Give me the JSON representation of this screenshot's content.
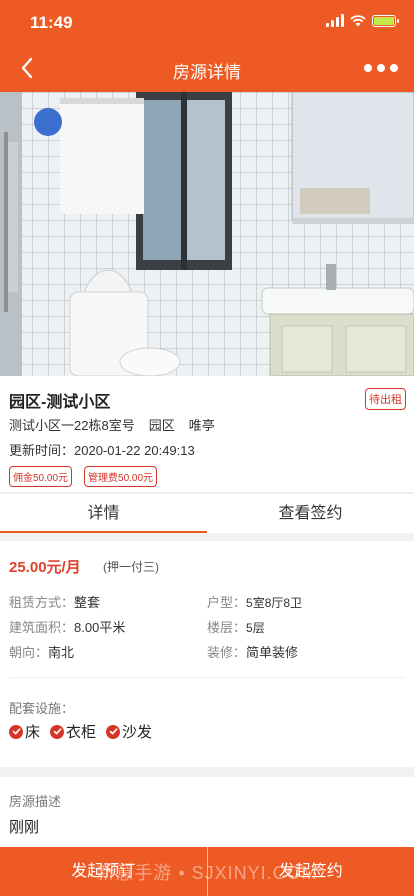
{
  "status_bar": {
    "time": "11:49"
  },
  "nav": {
    "title": "房源详情"
  },
  "property": {
    "name": "园区-测试小区",
    "rent_status": "待出租",
    "address": "测试小区一22栋8室号",
    "district": "园区",
    "area_name": "唯亭",
    "updated_label": "更新时间：",
    "updated_value": "2020-01-22 20:49:13",
    "tags": [
      "佣金50.00元",
      "管理费50.00元"
    ]
  },
  "tabs": [
    {
      "label": "详情",
      "active": true
    },
    {
      "label": "查看签约",
      "active": false
    }
  ],
  "detail": {
    "price": "25.00元/月",
    "payment": "(押一付三)",
    "rent_type_label": "租赁方式：",
    "rent_type": "整套",
    "layout_label": "户型：",
    "layout": "5室8厅8卫",
    "area_label": "建筑面积：",
    "area": "8.00平米",
    "floor_label": "楼层：",
    "floor": "5层",
    "orientation_label": "朝向：",
    "orientation": "南北",
    "decoration_label": "装修：",
    "decoration": "简单装修",
    "facilities_title": "配套设施：",
    "facilities": [
      "床",
      "衣柜",
      "沙发"
    ]
  },
  "description": {
    "title": "房源描述",
    "text": "刚刚"
  },
  "bottom": {
    "left": "发起预订",
    "right": "发起签约"
  },
  "watermark": "新意手游 • SJXINYI.COM",
  "colors": {
    "accent": "#ee5a24",
    "tag_red": "#d6362a",
    "price_red": "#e0402b"
  }
}
